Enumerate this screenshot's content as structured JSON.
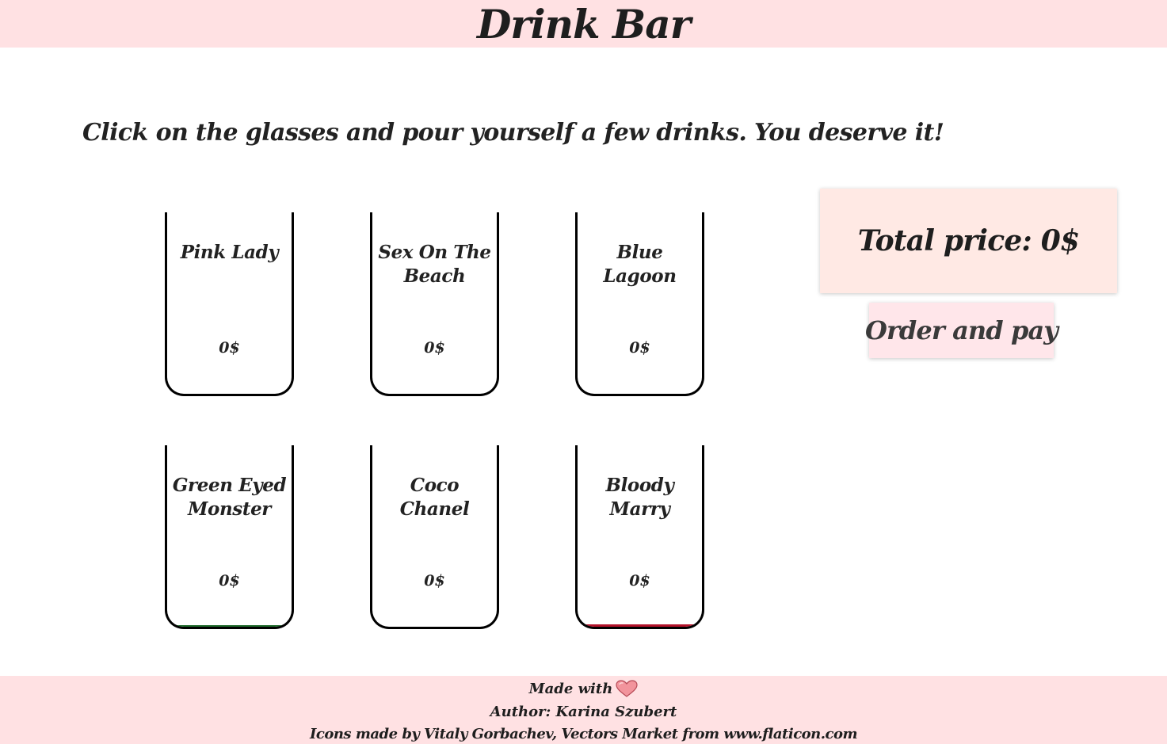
{
  "header": {
    "title": "Drink Bar"
  },
  "intro": "Click on the glasses and pour yourself a few drinks. You deserve it!",
  "drinks": [
    {
      "name": "Pink Lady",
      "price": "0$"
    },
    {
      "name": "Sex On The Beach",
      "price": "0$"
    },
    {
      "name": "Blue Lagoon",
      "price": "0$"
    },
    {
      "name": "Green Eyed Monster",
      "price": "0$",
      "fill_color": "#1f6b2c"
    },
    {
      "name": "Coco Chanel",
      "price": "0$"
    },
    {
      "name": "Bloody Marry",
      "price": "0$",
      "fill_color": "#b3122a"
    }
  ],
  "total": {
    "label": "Total price: 0$"
  },
  "order_button": {
    "label": "Order and pay"
  },
  "footer": {
    "made_with": "Made with",
    "heart_icon": "heart-icon",
    "author": "Author: Karina Szubert",
    "credits": "Icons made by Vitaly Gorbachev, Vectors Market from www.flaticon.com"
  },
  "colors": {
    "header_bg": "#ffe1e3",
    "total_bg": "#ffe9e4",
    "button_bg": "#ffe6ea",
    "heart": "#f2949c"
  }
}
